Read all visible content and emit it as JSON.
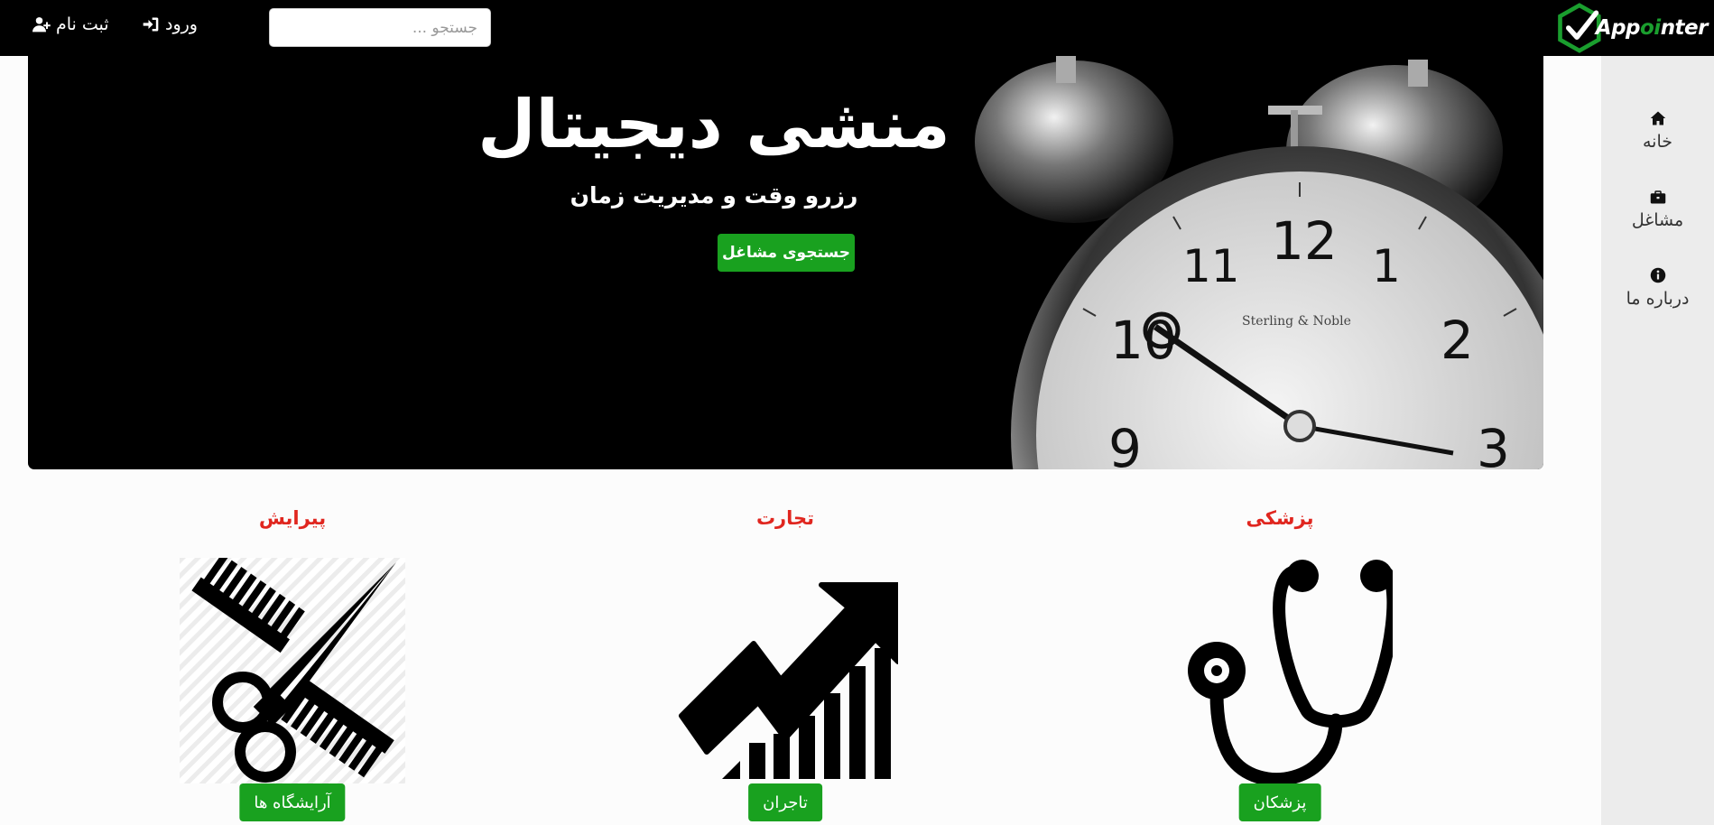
{
  "header": {
    "brand_name_part1": "App",
    "brand_name_accent": "oi",
    "brand_name_part2": "nter",
    "search_placeholder": "جستجو ...",
    "login_label": "ورود",
    "signup_label": "ثبت نام",
    "login_icon": "sign-in-icon",
    "signup_icon": "user-plus-icon"
  },
  "sidebar": {
    "items": [
      {
        "label": "خانه",
        "icon": "home-icon"
      },
      {
        "label": "مشاغل",
        "icon": "briefcase-icon"
      },
      {
        "label": "درباره ما",
        "icon": "info-circle-icon"
      }
    ]
  },
  "hero": {
    "title": "منشی دیجیتال",
    "subtitle": "رزرو وقت و مدیریت زمان",
    "button_label": "جستجوی مشاغل"
  },
  "categories": [
    {
      "title": "پیرایش",
      "button_label": "آرایشگاه ها",
      "icon": "scissors-comb-icon"
    },
    {
      "title": "تجارت",
      "button_label": "تاجران",
      "icon": "growth-chart-icon"
    },
    {
      "title": "پزشکی",
      "button_label": "پزشکان",
      "icon": "stethoscope-icon"
    }
  ],
  "colors": {
    "accent_green": "#19a11f",
    "category_title_red": "#e0261f",
    "topbar_bg": "#000000",
    "sidebar_bg": "#ececec"
  }
}
